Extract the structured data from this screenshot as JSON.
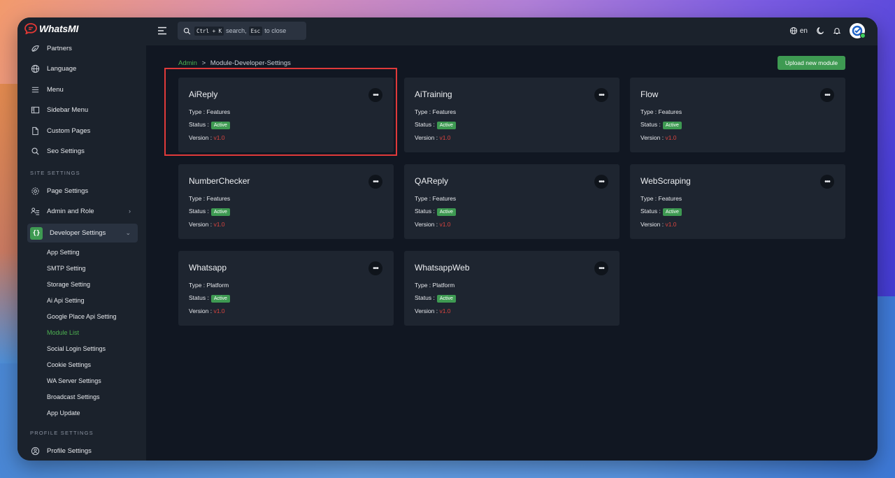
{
  "app": {
    "name": "WhatsMI"
  },
  "sidebar": {
    "items_top": [
      {
        "label": "Partners",
        "icon": "partners-icon"
      },
      {
        "label": "Language",
        "icon": "globe-icon"
      },
      {
        "label": "Menu",
        "icon": "menu-icon"
      },
      {
        "label": "Sidebar Menu",
        "icon": "sidebar-icon"
      },
      {
        "label": "Custom Pages",
        "icon": "document-icon"
      },
      {
        "label": "Seo Settings",
        "icon": "search-icon"
      }
    ],
    "site_settings_label": "SITE SETTINGS",
    "items_site": [
      {
        "label": "Page Settings",
        "icon": "gear-icon"
      },
      {
        "label": "Admin and Role",
        "icon": "admin-role-icon"
      },
      {
        "label": "Developer Settings",
        "icon": "code-braces-icon"
      }
    ],
    "dev_icon_glyph": "{}",
    "dev_sub": [
      "App Setting",
      "SMTP Setting",
      "Storage Setting",
      "Ai Api Setting",
      "Google Place Api Setting",
      "Module List",
      "Social Login Settings",
      "Cookie Settings",
      "WA Server Settings",
      "Broadcast Settings",
      "App Update"
    ],
    "profile_settings_label": "PROFILE SETTINGS",
    "profile_item": {
      "label": "Profile Settings",
      "icon": "user-circle-icon"
    }
  },
  "topbar": {
    "search_kbd1": "Ctrl + K",
    "search_mid": "search,",
    "search_kbd2": "Esc",
    "search_end": "to close",
    "lang": "en"
  },
  "breadcrumb": {
    "root": "Admin",
    "sep": ">",
    "current": "Module-Developer-Settings"
  },
  "upload_button": "Upload new module",
  "labels": {
    "type": "Type :",
    "status": "Status :",
    "version": "Version :"
  },
  "modules": [
    {
      "name": "AiReply",
      "type": "Features",
      "status": "Active",
      "version": "v1.0"
    },
    {
      "name": "AiTraining",
      "type": "Features",
      "status": "Active",
      "version": "v1.0"
    },
    {
      "name": "Flow",
      "type": "Features",
      "status": "Active",
      "version": "v1.0"
    },
    {
      "name": "NumberChecker",
      "type": "Features",
      "status": "Active",
      "version": "v1.0"
    },
    {
      "name": "QAReply",
      "type": "Features",
      "status": "Active",
      "version": "v1.0"
    },
    {
      "name": "WebScraping",
      "type": "Features",
      "status": "Active",
      "version": "v1.0"
    },
    {
      "name": "Whatsapp",
      "type": "Platform",
      "status": "Active",
      "version": "v1.0"
    },
    {
      "name": "WhatsappWeb",
      "type": "Platform",
      "status": "Active",
      "version": "v1.0"
    }
  ],
  "colors": {
    "accent": "#3e9a52",
    "version": "#d9443f",
    "highlight": "#e03a3a"
  }
}
